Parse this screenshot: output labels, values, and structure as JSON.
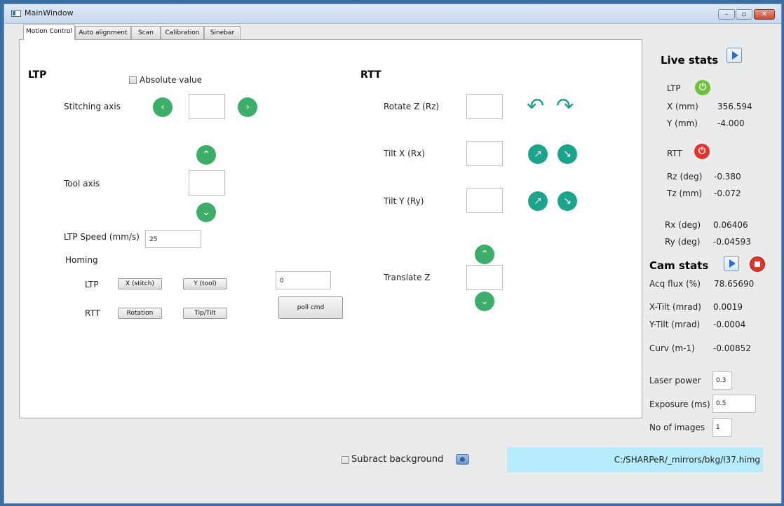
{
  "window": {
    "title": "MainWindow",
    "minimize": "–",
    "maximize": "▫",
    "close": "✕"
  },
  "tabs": [
    {
      "label": "Motion Control",
      "active": true
    },
    {
      "label": "Auto alignment"
    },
    {
      "label": "Scan"
    },
    {
      "label": "Calibration"
    },
    {
      "label": "Sinebar"
    }
  ],
  "ltp": {
    "heading": "LTP",
    "absolute_value_label": "Absolute value",
    "absolute_value_checked": false,
    "stitching_axis_label": "Stitching axis",
    "stitching_axis_value": "",
    "tool_axis_label": "Tool axis",
    "tool_axis_value": "",
    "speed_label": "LTP Speed (mm/s)",
    "speed_value": "25",
    "homing_label": "Homing",
    "homing_ltp_label": "LTP",
    "homing_rtt_label": "RTT",
    "x_stitch_button": "X (stitch)",
    "y_tool_button": "Y (tool)",
    "rotation_button": "Rotation",
    "tip_tilt_button": "Tip/Tilt",
    "cmd_value": "0",
    "poll_cmd_button": "poll cmd"
  },
  "rtt": {
    "heading": "RTT",
    "rotate_z_label": "Rotate Z (Rz)",
    "rotate_z_value": "",
    "tilt_x_label": "Tilt X (Rx)",
    "tilt_x_value": "",
    "tilt_y_label": "Tilt Y (Ry)",
    "tilt_y_value": "",
    "translate_z_label": "Translate Z",
    "translate_z_value": ""
  },
  "live_stats": {
    "heading": "Live stats",
    "ltp_label": "LTP",
    "ltp_status_color": "#6cc43a",
    "x_label": "X (mm)",
    "x_value": "356.594",
    "y_label": "Y (mm)",
    "y_value": "-4.000",
    "rtt_label": "RTT",
    "rtt_status_color": "#e0342c",
    "rz_label": "Rz (deg)",
    "rz_value": "-0.380",
    "tz_label": "Tz (mm)",
    "tz_value": "-0.072",
    "rx_label": "Rx (deg)",
    "rx_value": "0.06406",
    "ry_label": "Ry (deg)",
    "ry_value": "-0.04593"
  },
  "cam_stats": {
    "heading": "Cam stats",
    "acq_flux_label": "Acq flux (%)",
    "acq_flux_value": "78.65690",
    "x_tilt_label": "X-Tilt (mrad)",
    "x_tilt_value": "0.0019",
    "y_tilt_label": "Y-Tilt (mrad)",
    "y_tilt_value": "-0.0004",
    "curv_label": "Curv (m-1)",
    "curv_value": "-0.00852",
    "laser_power_label": "Laser power",
    "laser_power_value": "0.3",
    "exposure_label": "Exposure (ms)",
    "exposure_value": "0.5",
    "no_images_label": "No of images",
    "no_images_value": "1"
  },
  "bottom": {
    "subtract_background_label": "Subract background",
    "subtract_background_checked": false,
    "background_path": "C:/SHARPeR/_mirrors/bkg/I37.himg"
  }
}
